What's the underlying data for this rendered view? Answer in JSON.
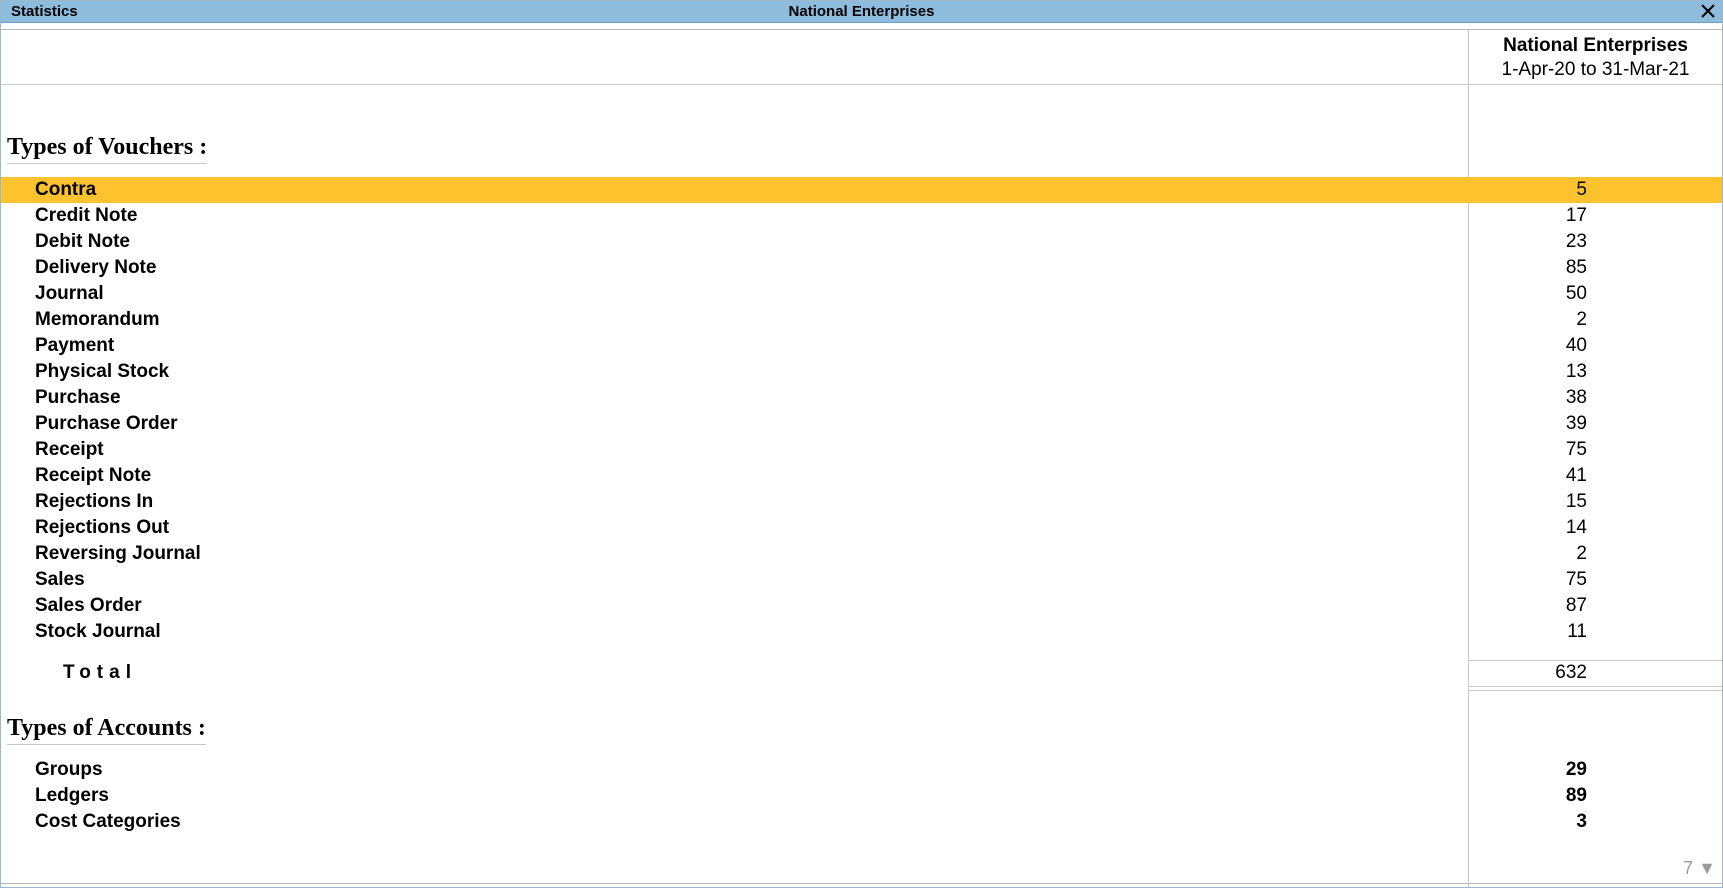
{
  "titlebar": {
    "left": "Statistics",
    "center": "National Enterprises"
  },
  "column": {
    "company": "National Enterprises",
    "period": "1-Apr-20 to 31-Mar-21"
  },
  "vouchers": {
    "title": "Types of Vouchers :",
    "rows": [
      {
        "label": "Contra",
        "value": "5"
      },
      {
        "label": "Credit Note",
        "value": "17"
      },
      {
        "label": "Debit Note",
        "value": "23"
      },
      {
        "label": "Delivery Note",
        "value": "85"
      },
      {
        "label": "Journal",
        "value": "50"
      },
      {
        "label": "Memorandum",
        "value": "2"
      },
      {
        "label": "Payment",
        "value": "40"
      },
      {
        "label": "Physical Stock",
        "value": "13"
      },
      {
        "label": "Purchase",
        "value": "38"
      },
      {
        "label": "Purchase Order",
        "value": "39"
      },
      {
        "label": "Receipt",
        "value": "75"
      },
      {
        "label": "Receipt Note",
        "value": "41"
      },
      {
        "label": "Rejections In",
        "value": "15"
      },
      {
        "label": "Rejections Out",
        "value": "14"
      },
      {
        "label": "Reversing Journal",
        "value": "2"
      },
      {
        "label": "Sales",
        "value": "75"
      },
      {
        "label": "Sales Order",
        "value": "87"
      },
      {
        "label": "Stock Journal",
        "value": "11"
      }
    ],
    "total_label": "Total",
    "total_value": "632"
  },
  "accounts": {
    "title": "Types of Accounts :",
    "rows": [
      {
        "label": "Groups",
        "value": "29"
      },
      {
        "label": "Ledgers",
        "value": "89"
      },
      {
        "label": "Cost Categories",
        "value": "3"
      }
    ]
  },
  "pager": {
    "text": "7 ▼"
  },
  "colors": {
    "titlebar": "#8ebcdc",
    "highlight": "#fdc22d"
  }
}
